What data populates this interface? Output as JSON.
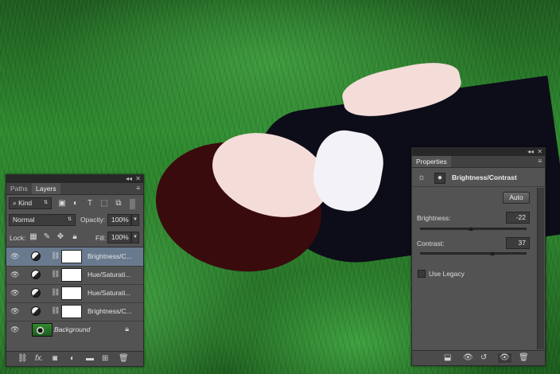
{
  "layers_panel": {
    "tabs": [
      "Paths",
      "Layers"
    ],
    "active_tab": "Layers",
    "filter": {
      "label": "Kind"
    },
    "blend_mode": "Normal",
    "opacity": {
      "label": "Opacity:",
      "value": "100%"
    },
    "lock": {
      "label": "Lock:"
    },
    "fill": {
      "label": "Fill:",
      "value": "100%"
    },
    "layers": [
      {
        "name": "Brightness/C...",
        "type": "adjustment",
        "selected": true
      },
      {
        "name": "Hue/Saturati...",
        "type": "adjustment",
        "selected": false
      },
      {
        "name": "Hue/Saturati...",
        "type": "adjustment",
        "selected": false
      },
      {
        "name": "Brightness/C...",
        "type": "adjustment",
        "selected": false
      },
      {
        "name": "Background",
        "type": "image",
        "selected": false,
        "locked": true
      }
    ],
    "bottom_fx_label": "fx."
  },
  "properties_panel": {
    "tab": "Properties",
    "title": "Brightness/Contrast",
    "auto_label": "Auto",
    "brightness": {
      "label": "Brightness:",
      "value": "-22",
      "slider_fraction": 0.48
    },
    "contrast": {
      "label": "Contrast:",
      "value": "37",
      "slider_fraction": 0.68
    },
    "use_legacy": {
      "label": "Use Legacy",
      "checked": false
    }
  },
  "colors": {
    "panel_bg": "#535353",
    "selected_layer": "#697a8f",
    "grass": "#2f8a30"
  }
}
